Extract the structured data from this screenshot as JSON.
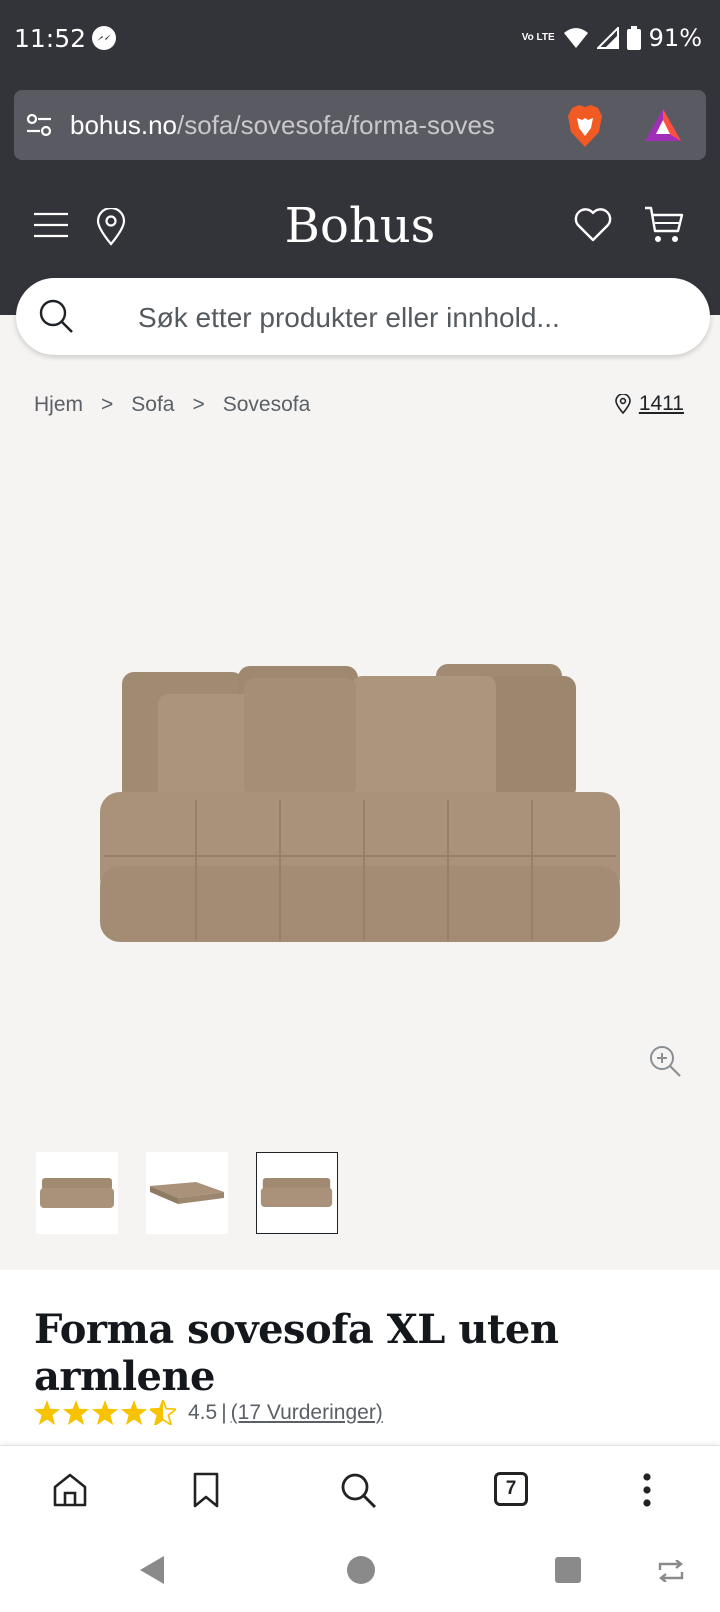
{
  "status_bar": {
    "time": "11:52",
    "network": "Vo LTE",
    "battery": "91%"
  },
  "browser": {
    "url_host": "bohus.no",
    "url_path": "/sofa/sovesofa/forma-soves",
    "tab_count": "7"
  },
  "site": {
    "logo": "Bohus",
    "search_placeholder": "Søk etter produkter eller innhold..."
  },
  "breadcrumb": {
    "items": [
      "Hjem",
      "Sofa",
      "Sovesofa"
    ],
    "separator": ">"
  },
  "store": {
    "label": "1411"
  },
  "product": {
    "title": "Forma sovesofa XL uten armlene",
    "rating_value": "4.5",
    "rating_separator": "|",
    "reviews_label": "(17 Vurderinger)",
    "rating_stars": 4.5,
    "rating_max": 5,
    "thumbnails_count": 3,
    "active_thumbnail_index": 2
  },
  "colors": {
    "header_bg": "#33333a",
    "star": "#f7c300",
    "sofa": "#a8917a"
  }
}
